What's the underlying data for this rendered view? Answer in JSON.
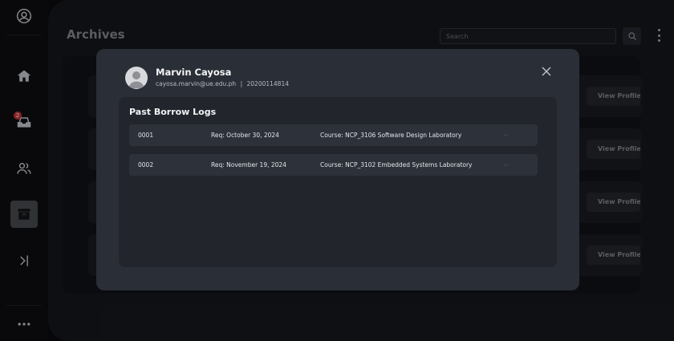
{
  "sidebar": {
    "items": [
      {
        "icon": "home-icon"
      },
      {
        "icon": "inbox-icon",
        "badge": "2"
      },
      {
        "icon": "users-icon"
      },
      {
        "icon": "archive-icon",
        "active": true
      },
      {
        "icon": "collapse-sidebar-icon"
      },
      {
        "icon": "more-icon"
      }
    ],
    "profile_icon": "user-circle-icon"
  },
  "header": {
    "title": "Archives",
    "search_placeholder": "Search"
  },
  "background_list": {
    "view_profile_label": "View Profile"
  },
  "modal": {
    "user_name": "Marvin Cayosa",
    "email": "cayosa.marvin@ue.edu.ph",
    "separator": "|",
    "student_id": "20200114814",
    "section_title": "Past Borrow Logs",
    "logs": [
      {
        "id": "0001",
        "req": "Req: October 30, 2024",
        "course": "Course: NCP_3106 Software Design Laboratory"
      },
      {
        "id": "0002",
        "req": "Req: November 19, 2024",
        "course": "Course: NCP_3102 Embedded Systems Laboratory"
      }
    ]
  },
  "colors": {
    "background": "#0b0c0f",
    "main": "#16181d",
    "modal": "#2a2e36",
    "badge": "#d2383c"
  }
}
